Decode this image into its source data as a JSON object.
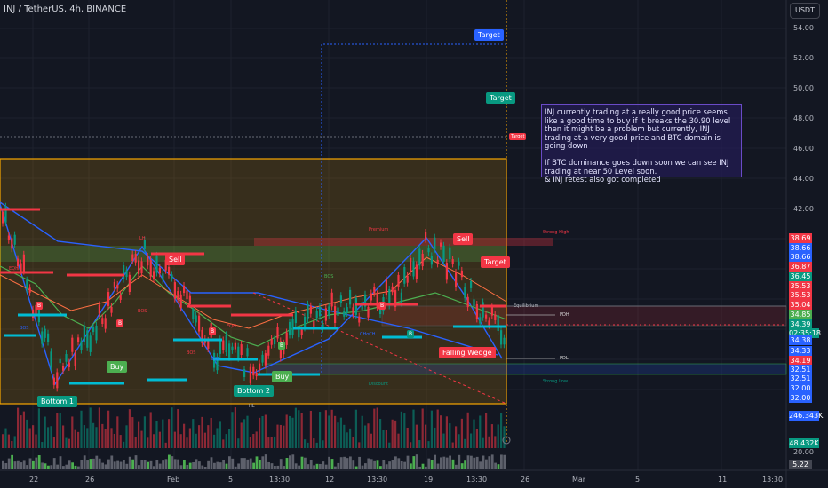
{
  "header": {
    "symbol": "INJ / TetherUS, 4h, BINANCE",
    "currency": "USDT"
  },
  "price_axis": {
    "ticks": [
      "54.00",
      "52.00",
      "50.00",
      "48.00",
      "46.00",
      "44.00",
      "42.00"
    ]
  },
  "price_tags": [
    {
      "text": "38.69",
      "color": "#f23645"
    },
    {
      "text": "38.66",
      "color": "#2962ff"
    },
    {
      "text": "38.66",
      "color": "#2962ff"
    },
    {
      "text": "36.87",
      "color": "#f23645"
    },
    {
      "text": "36.45",
      "color": "#089981"
    },
    {
      "text": "35.53",
      "color": "#f23645"
    },
    {
      "text": "35.53",
      "color": "#f23645"
    },
    {
      "text": "35.04",
      "color": "#f23645"
    },
    {
      "text": "34.85",
      "color": "#4caf50"
    },
    {
      "text": "34.39",
      "color": "#089981"
    },
    {
      "text": "02:35:18",
      "color": "#089981"
    },
    {
      "text": "34.38",
      "color": "#2962ff"
    },
    {
      "text": "34.33",
      "color": "#2962ff"
    },
    {
      "text": "34.19",
      "color": "#f23645"
    },
    {
      "text": "32.51",
      "color": "#2962ff"
    },
    {
      "text": "32.51",
      "color": "#2962ff"
    },
    {
      "text": "32.00",
      "color": "#2962ff"
    },
    {
      "text": "32.00",
      "color": "#2962ff"
    }
  ],
  "volume_tags": [
    {
      "text": "246.343K",
      "color": "#2962ff"
    },
    {
      "text": "48.432K",
      "color": "#089981"
    }
  ],
  "osc_ticks": [
    "20.00",
    "5.22"
  ],
  "x_axis": [
    "22",
    "26",
    "Feb",
    "5",
    "13:30",
    "12",
    "13:30",
    "19",
    "13:30",
    "26",
    "Mar",
    "5",
    "11",
    "13:30"
  ],
  "labels": {
    "target_blue": "Target",
    "target_green": "Target",
    "target_small": "Target",
    "target_red": "Target",
    "sell_1": "Sell",
    "sell_2": "Sell",
    "buy_1": "Buy",
    "buy_2": "Buy",
    "bottom_1": "Bottom 1",
    "bottom_2": "Bottom 2",
    "falling_wedge": "Falling Wedge",
    "premium": "Premium",
    "equilibrium": "Equilibrium",
    "pdh": "PDH",
    "pdl": "PDL",
    "discount": "Discount",
    "strong_high": "Strong High",
    "strong_low": "Strong Low",
    "lh": "LH",
    "bos": "BOS",
    "eqh": "EQH",
    "eql": "EQL",
    "choch": "CHoCH",
    "b": "B",
    "hl": "HL"
  },
  "note": {
    "text": "INJ currently trading at a really good price seems like a good time to buy if it breaks the 30.90 level then it might be a problem but currently, INJ trading at a very good price and BTC domain is going down\n\nIf BTC dominance goes down soon we can see INJ trading at near 50 Level soon.\n& INJ retest also got completed"
  },
  "colors": {
    "bg": "#131722",
    "up": "#089981",
    "down": "#f23645",
    "blue": "#2962ff",
    "cyan": "#00bcd4",
    "orange": "#f7a600"
  }
}
